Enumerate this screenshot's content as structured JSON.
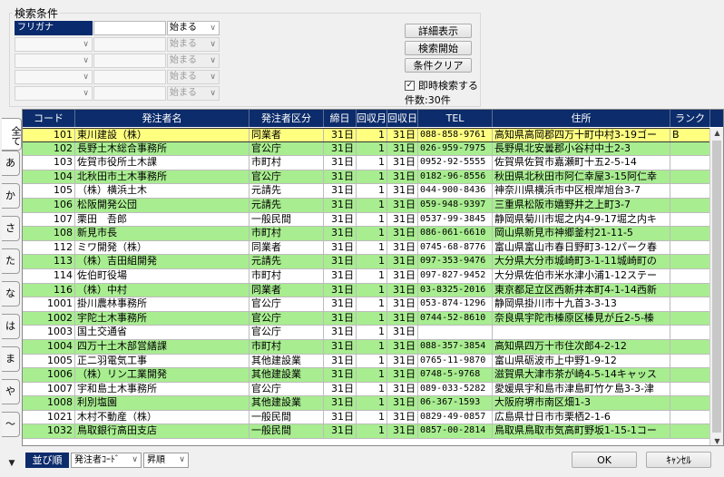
{
  "search": {
    "title": "検索条件",
    "rows": [
      {
        "field": "フリガナ",
        "operator": "始まる",
        "active": true,
        "disabled": false
      },
      {
        "field": "",
        "operator": "始まる",
        "active": false,
        "disabled": true
      },
      {
        "field": "",
        "operator": "始まる",
        "active": false,
        "disabled": true
      },
      {
        "field": "",
        "operator": "始まる",
        "active": false,
        "disabled": true
      },
      {
        "field": "",
        "operator": "始まる",
        "active": false,
        "disabled": true
      }
    ],
    "buttons": {
      "detail": "詳細表示",
      "start": "検索開始",
      "clear": "条件クリア"
    },
    "instant_search_label": "即時検索する",
    "instant_search_checked": true,
    "count_label": "件数:30件"
  },
  "kana_tabs": [
    "全て",
    "あ",
    "か",
    "さ",
    "た",
    "な",
    "は",
    "ま",
    "や",
    "～"
  ],
  "grid": {
    "columns": [
      "コード",
      "発注者名",
      "発注者区分",
      "締日",
      "回収月",
      "回収日",
      "TEL",
      "住所",
      "ランク"
    ],
    "rows": [
      {
        "code": "101",
        "name": "東川建設（株）",
        "category": "同業者",
        "close": "31日",
        "month": "1",
        "day": "31日",
        "tel": "088-858-9761",
        "address": "高知県高岡郡四万十町中村3-19ゴー",
        "rank": "B",
        "style": "selected"
      },
      {
        "code": "102",
        "name": "長野土木総合事務所",
        "category": "官公庁",
        "close": "31日",
        "month": "1",
        "day": "31日",
        "tel": "026-959-7975",
        "address": "長野県北安曇郡小谷村中土2-3",
        "rank": "",
        "style": "green"
      },
      {
        "code": "103",
        "name": "佐賀市役所土木課",
        "category": "市町村",
        "close": "31日",
        "month": "1",
        "day": "31日",
        "tel": "0952-92-5555",
        "address": "佐賀県佐賀市嘉瀬町十五2-5-14",
        "rank": "",
        "style": "white"
      },
      {
        "code": "104",
        "name": "北秋田市土木事務所",
        "category": "官公庁",
        "close": "31日",
        "month": "1",
        "day": "31日",
        "tel": "0182-96-8556",
        "address": "秋田県北秋田市阿仁幸屋3-15阿仁幸",
        "rank": "",
        "style": "green"
      },
      {
        "code": "105",
        "name": "（株）横浜土木",
        "category": "元請先",
        "close": "31日",
        "month": "1",
        "day": "31日",
        "tel": "044-900-8436",
        "address": "神奈川県横浜市中区根岸旭台3-7",
        "rank": "",
        "style": "white"
      },
      {
        "code": "106",
        "name": "松阪開発公団",
        "category": "元請先",
        "close": "31日",
        "month": "1",
        "day": "31日",
        "tel": "059-948-9397",
        "address": "三重県松阪市嬉野井之上町3-7",
        "rank": "",
        "style": "green"
      },
      {
        "code": "107",
        "name": "栗田　吾郎",
        "category": "一般民間",
        "close": "31日",
        "month": "1",
        "day": "31日",
        "tel": "0537-99-3845",
        "address": "静岡県菊川市堀之内4-9-17堀之内キ",
        "rank": "",
        "style": "white"
      },
      {
        "code": "108",
        "name": "新見市長",
        "category": "市町村",
        "close": "31日",
        "month": "1",
        "day": "31日",
        "tel": "086-061-6610",
        "address": "岡山県新見市神郷釜村21-11-5",
        "rank": "",
        "style": "green"
      },
      {
        "code": "112",
        "name": "ミワ開発（株）",
        "category": "同業者",
        "close": "31日",
        "month": "1",
        "day": "31日",
        "tel": "0745-68-8776",
        "address": "富山県富山市春日野町3-12パーク春",
        "rank": "",
        "style": "white"
      },
      {
        "code": "113",
        "name": "（株）吉田組開発",
        "category": "元請先",
        "close": "31日",
        "month": "1",
        "day": "31日",
        "tel": "097-353-9476",
        "address": "大分県大分市城崎町3-1-11城崎町の",
        "rank": "",
        "style": "green"
      },
      {
        "code": "114",
        "name": "佐伯町役場",
        "category": "市町村",
        "close": "31日",
        "month": "1",
        "day": "31日",
        "tel": "097-827-9452",
        "address": "大分県佐伯市米水津小浦1-12ステー",
        "rank": "",
        "style": "white"
      },
      {
        "code": "116",
        "name": "（株）中村",
        "category": "同業者",
        "close": "31日",
        "month": "1",
        "day": "31日",
        "tel": "03-8325-2016",
        "address": "東京都足立区西新井本町4-1-14西新",
        "rank": "",
        "style": "green"
      },
      {
        "code": "1001",
        "name": "掛川農林事務所",
        "category": "官公庁",
        "close": "31日",
        "month": "1",
        "day": "31日",
        "tel": "053-874-1296",
        "address": "静岡県掛川市十九首3-3-13",
        "rank": "",
        "style": "white"
      },
      {
        "code": "1002",
        "name": "宇陀土木事務所",
        "category": "官公庁",
        "close": "31日",
        "month": "1",
        "day": "31日",
        "tel": "0744-52-8610",
        "address": "奈良県宇陀市榛原区榛見が丘2-5-榛",
        "rank": "",
        "style": "green"
      },
      {
        "code": "1003",
        "name": "国土交通省",
        "category": "官公庁",
        "close": "31日",
        "month": "1",
        "day": "31日",
        "tel": "",
        "address": "",
        "rank": "",
        "style": "white"
      },
      {
        "code": "1004",
        "name": "四万十土木部営繕課",
        "category": "市町村",
        "close": "31日",
        "month": "1",
        "day": "31日",
        "tel": "088-357-3854",
        "address": "高知県四万十市住次郎4-2-12",
        "rank": "",
        "style": "green"
      },
      {
        "code": "1005",
        "name": "正二羽電気工事",
        "category": "其他建設業",
        "close": "31日",
        "month": "1",
        "day": "31日",
        "tel": "0765-11-9870",
        "address": "富山県砺波市上中野1-9-12",
        "rank": "",
        "style": "white"
      },
      {
        "code": "1006",
        "name": "（株）リン工業開発",
        "category": "其他建設業",
        "close": "31日",
        "month": "1",
        "day": "31日",
        "tel": "0748-5-9768",
        "address": "滋賀県大津市茶が崎4-5-14キャッス",
        "rank": "",
        "style": "green"
      },
      {
        "code": "1007",
        "name": "宇和島土木事務所",
        "category": "官公庁",
        "close": "31日",
        "month": "1",
        "day": "31日",
        "tel": "089-033-5282",
        "address": "愛媛県宇和島市津島町竹ケ島3-3-津",
        "rank": "",
        "style": "white"
      },
      {
        "code": "1008",
        "name": "利別塩園",
        "category": "其他建設業",
        "close": "31日",
        "month": "1",
        "day": "31日",
        "tel": "06-367-1593",
        "address": "大阪府堺市南区畑1-3",
        "rank": "",
        "style": "green"
      },
      {
        "code": "1021",
        "name": "木村不動産（株）",
        "category": "一般民間",
        "close": "31日",
        "month": "1",
        "day": "31日",
        "tel": "0829-49-0857",
        "address": "広島県廿日市市栗栖2-1-6",
        "rank": "",
        "style": "white"
      },
      {
        "code": "1032",
        "name": "鳥取銀行高田支店",
        "category": "一般民間",
        "close": "31日",
        "month": "1",
        "day": "31日",
        "tel": "0857-00-2814",
        "address": "鳥取県鳥取市気高町野坂1-15-1コー",
        "rank": "",
        "style": "green"
      }
    ]
  },
  "bottom": {
    "sort_label": "並び順",
    "sort_field": "発注者ｺｰﾄﾞ",
    "sort_order": "昇順",
    "ok": "OK",
    "cancel": "ｷｬﾝｾﾙ"
  }
}
